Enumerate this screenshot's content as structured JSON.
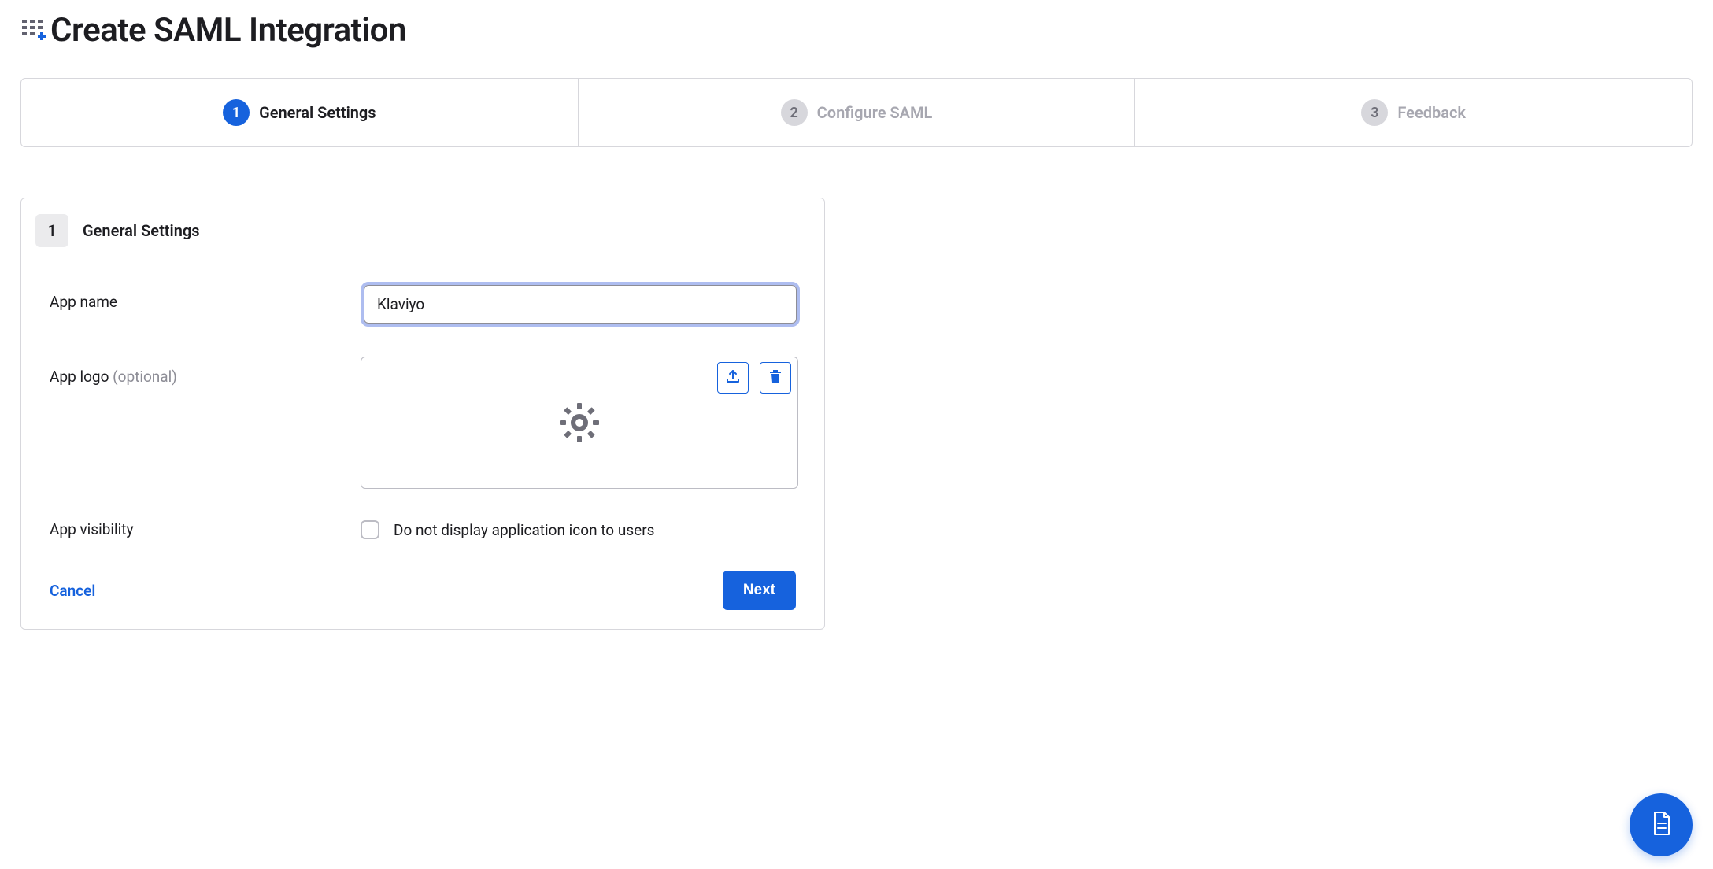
{
  "header": {
    "title": "Create SAML Integration"
  },
  "steps": [
    {
      "number": "1",
      "label": "General Settings",
      "active": true
    },
    {
      "number": "2",
      "label": "Configure SAML",
      "active": false
    },
    {
      "number": "3",
      "label": "Feedback",
      "active": false
    }
  ],
  "section": {
    "number": "1",
    "title": "General Settings"
  },
  "fields": {
    "app_name": {
      "label": "App name",
      "value": "Klaviyo"
    },
    "app_logo": {
      "label": "App logo ",
      "optional": "(optional)"
    },
    "app_visibility": {
      "label": "App visibility",
      "checkbox_label": "Do not display application icon to users"
    }
  },
  "buttons": {
    "cancel": "Cancel",
    "next": "Next"
  },
  "colors": {
    "primary": "#1662dd",
    "focus_ring": "#aebdf0",
    "muted": "#8d8d96"
  }
}
